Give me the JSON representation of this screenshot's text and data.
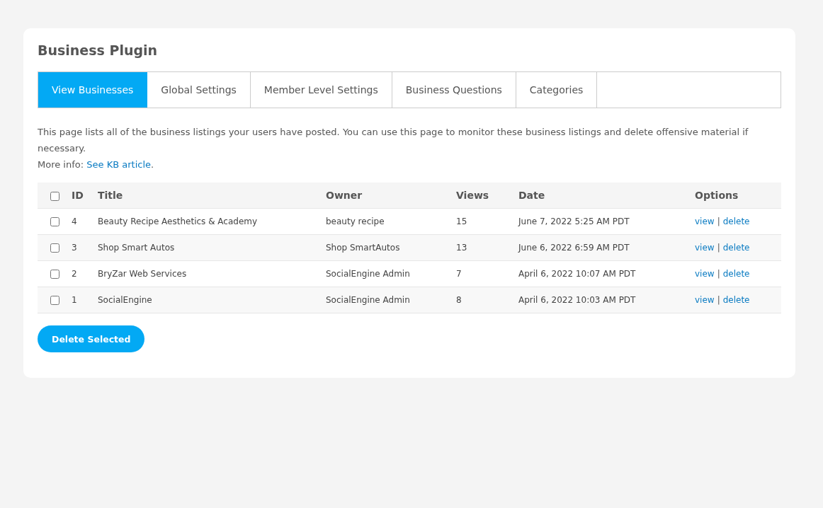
{
  "title": "Business Plugin",
  "tabs": [
    {
      "label": "View Businesses",
      "selected": true
    },
    {
      "label": "Global Settings",
      "selected": false
    },
    {
      "label": "Member Level Settings",
      "selected": false
    },
    {
      "label": "Business Questions",
      "selected": false
    },
    {
      "label": "Categories",
      "selected": false
    }
  ],
  "description": {
    "text": "This page lists all of the business listings your users have posted. You can use this page to monitor these business listings and delete offensive material if necessary.",
    "more_info": "More info:",
    "link": "See KB article",
    "end": "."
  },
  "table": {
    "select_all_checked": false,
    "columns": [
      "ID",
      "Title",
      "Owner",
      "Views",
      "Date",
      "Options"
    ],
    "rows": [
      {
        "checked": false,
        "id": "4",
        "title": "Beauty Recipe Aesthetics & Academy",
        "owner": "beauty recipe",
        "views": "15",
        "date": "June 7, 2022 5:25 AM PDT",
        "options": [
          "view",
          "|",
          "delete"
        ]
      },
      {
        "checked": false,
        "id": "3",
        "title": "Shop Smart Autos",
        "owner": "Shop SmartAutos",
        "views": "13",
        "date": "June 6, 2022 6:59 AM PDT",
        "options": [
          "view",
          "|",
          "delete"
        ]
      },
      {
        "checked": false,
        "id": "2",
        "title": "BryZar Web Services",
        "owner": "SocialEngine Admin",
        "views": "7",
        "date": "April 6, 2022 10:07 AM PDT",
        "options": [
          "view",
          "|",
          "delete"
        ]
      },
      {
        "checked": false,
        "id": "1",
        "title": "SocialEngine",
        "owner": "SocialEngine Admin",
        "views": "8",
        "date": "April 6, 2022 10:03 AM PDT",
        "options": [
          "view",
          "|",
          "delete"
        ]
      }
    ]
  },
  "delete_button": "Delete Selected"
}
